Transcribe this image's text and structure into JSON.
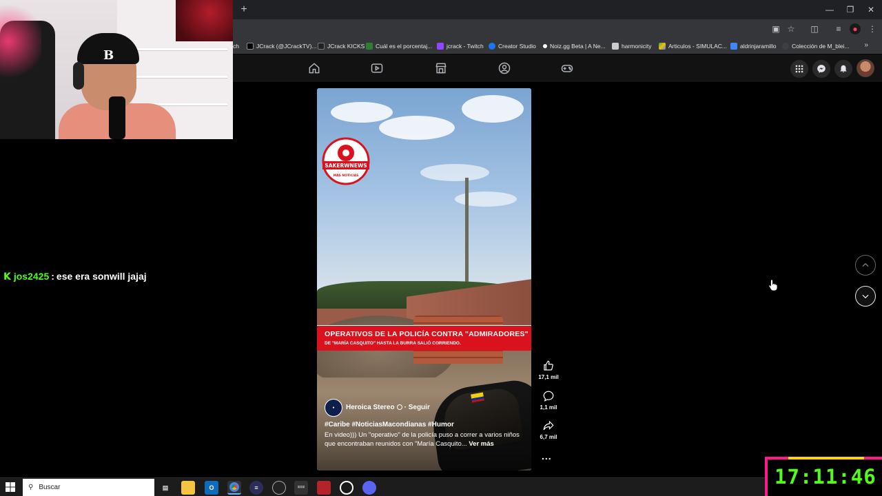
{
  "browser": {
    "new_tab_symbol": "+",
    "bookmarks": [
      {
        "label": "ch",
        "color": "#9146ff"
      },
      {
        "label": "JCrack (@JCrackTV)...",
        "color": "#000000"
      },
      {
        "label": "JCrack KICKS",
        "color": "#53fc18"
      },
      {
        "label": "Cuál es el porcentaj...",
        "color": "#2e7d32"
      },
      {
        "label": "jcrack - Twitch",
        "color": "#9146ff"
      },
      {
        "label": "Creator Studio",
        "color": "#1877f2"
      },
      {
        "label": "Noiz.gg Beta | A Ne...",
        "color": "#ffffff"
      },
      {
        "label": "harmonicity",
        "color": "#cccccc"
      },
      {
        "label": "Articulos - SIMULAC...",
        "color": "#34a853"
      },
      {
        "label": "aldrinjaramillo",
        "color": "#4285f4"
      },
      {
        "label": "Colección de M_blei...",
        "color": "#3c4043"
      }
    ]
  },
  "chat": {
    "badge": "K",
    "username": "jos2425",
    "separator": ":",
    "message": "ese era sonwill jajaj"
  },
  "reel": {
    "watermark": "SAKERWNEWS",
    "watermark_sub": "MÁS NOTICIAS",
    "banner_title": "OPERATIVOS DE LA POLICÍA CONTRA \"ADMIRADORES\"",
    "banner_sub": "DE \"MARÍA CASQUITO\" HASTA LA BURRA SALIÓ CORRIENDO.",
    "page_name": "Heroica Stereo",
    "follow_sep": "·",
    "follow": "Seguir",
    "hashtags": "#Caribe #NoticiasMacondianas #Humor",
    "caption": "En video))) Un \"operativo\" de la policía puso a correr a varios niños que encontraban reunidos con \"María Casquito...",
    "see_more": "Ver más"
  },
  "actions": {
    "likes": "17,1 mil",
    "comments": "1,1 mil",
    "shares": "6,7 mil",
    "more": "..."
  },
  "taskbar": {
    "search_label": "Buscar"
  },
  "overlay": {
    "clock": "17:11:46"
  },
  "colors": {
    "accent_green": "#53fc18",
    "banner_red": "#d9121d",
    "clock_border": "#ff1a8c"
  }
}
